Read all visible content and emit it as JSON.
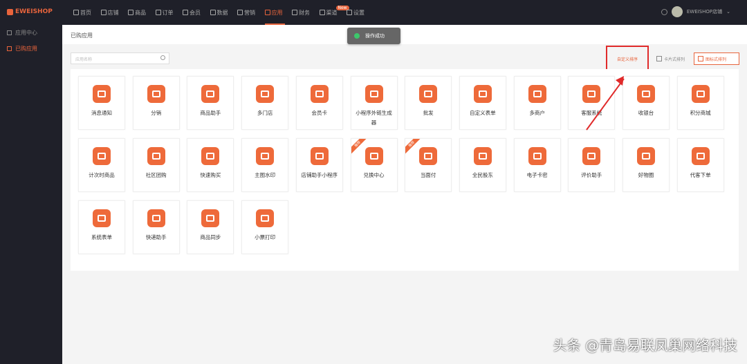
{
  "brand": "EWEISHOP",
  "nav": [
    {
      "label": "首页"
    },
    {
      "label": "店铺"
    },
    {
      "label": "商品"
    },
    {
      "label": "订单"
    },
    {
      "label": "会员"
    },
    {
      "label": "数据"
    },
    {
      "label": "营销"
    },
    {
      "label": "应用",
      "active": true
    },
    {
      "label": "财务"
    },
    {
      "label": "渠道",
      "badge": "New"
    },
    {
      "label": "设置"
    }
  ],
  "user": {
    "name": "EWEISHOP店铺"
  },
  "sidebar": [
    {
      "label": "应用中心"
    },
    {
      "label": "已购应用",
      "active": true
    }
  ],
  "page_title": "已购应用",
  "toast": "操作成功",
  "search": {
    "placeholder": "应用名称"
  },
  "buttons": {
    "custom_sort": "自定义排序",
    "card_view": "卡片式排列",
    "icon_view": "图标式排列"
  },
  "apps": [
    {
      "label": "消息通知"
    },
    {
      "label": "分销"
    },
    {
      "label": "商品助手"
    },
    {
      "label": "多门店"
    },
    {
      "label": "会员卡"
    },
    {
      "label": "小程序外链生成器"
    },
    {
      "label": "批发"
    },
    {
      "label": "自定义表单"
    },
    {
      "label": "多商户"
    },
    {
      "label": "客服系统"
    },
    {
      "label": "收银台"
    },
    {
      "label": "积分商城"
    },
    {
      "label": "计次时商品"
    },
    {
      "label": "社区团购"
    },
    {
      "label": "快速购买"
    },
    {
      "label": "主图水印"
    },
    {
      "label": "店铺助手小程序"
    },
    {
      "label": "兑换中心",
      "ribbon": "推荐"
    },
    {
      "label": "当面付",
      "ribbon": "推荐"
    },
    {
      "label": "全民股东"
    },
    {
      "label": "电子卡密"
    },
    {
      "label": "评价助手"
    },
    {
      "label": "好物圈"
    },
    {
      "label": "代客下单"
    },
    {
      "label": "系统表单"
    },
    {
      "label": "快递助手"
    },
    {
      "label": "商品同步"
    },
    {
      "label": "小票打印"
    }
  ],
  "watermark": "头条 @青岛易联凤巢网络科技",
  "colors": {
    "accent": "#ee6a3a",
    "topbar": "#1f2029",
    "annotation": "#e02a2a"
  }
}
